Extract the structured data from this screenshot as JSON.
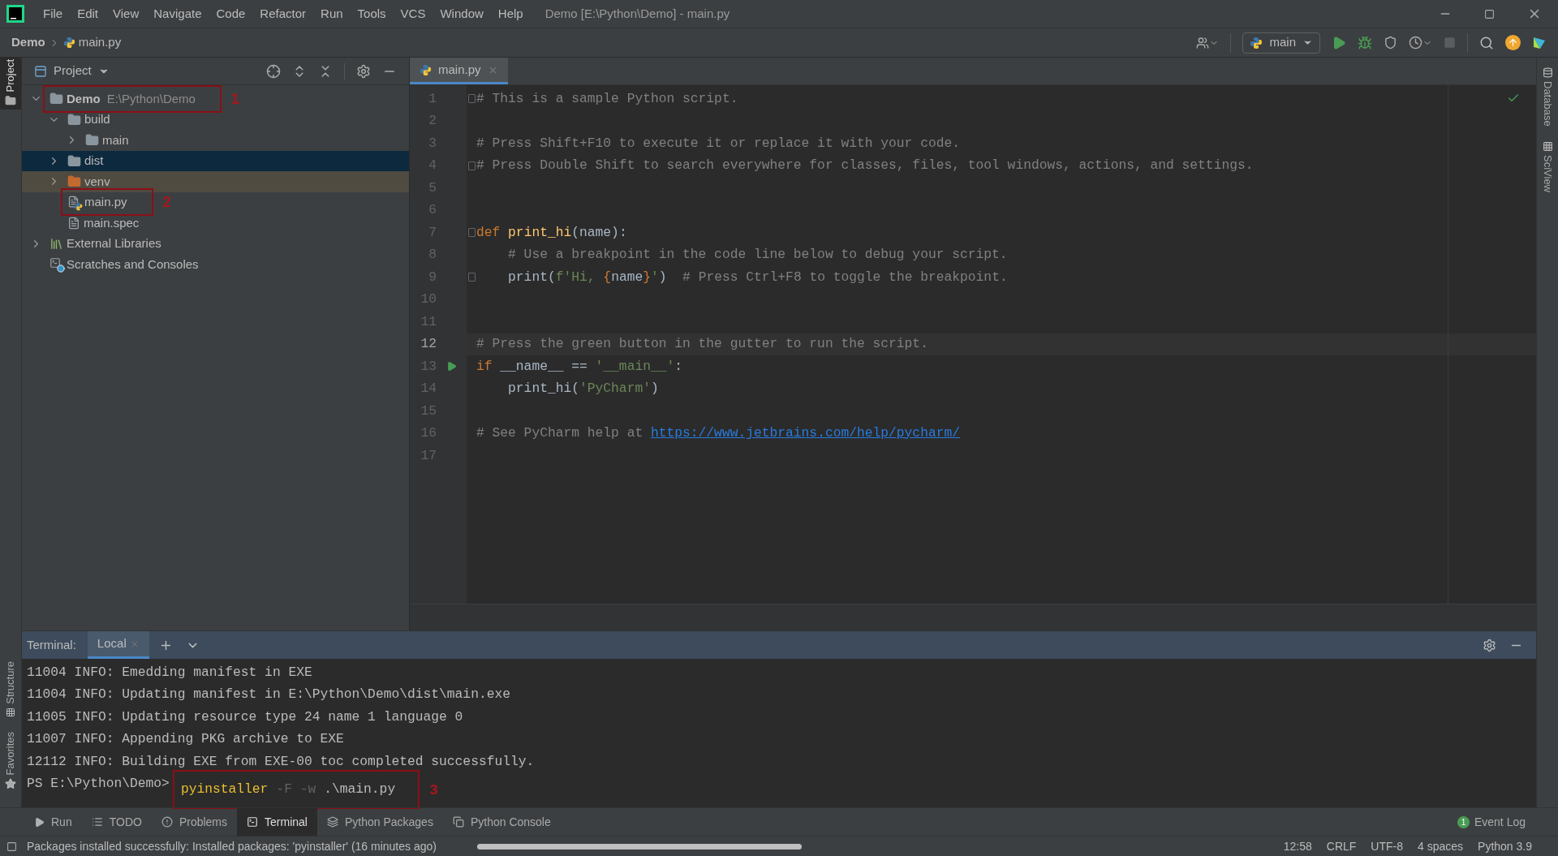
{
  "window": {
    "title": "Demo [E:\\Python\\Demo] - main.py"
  },
  "menu": [
    "File",
    "Edit",
    "View",
    "Navigate",
    "Code",
    "Refactor",
    "Run",
    "Tools",
    "VCS",
    "Window",
    "Help"
  ],
  "breadcrumbs": [
    "Demo",
    "main.py"
  ],
  "run_config": {
    "label": "main"
  },
  "left_strip": [
    {
      "label": "Project",
      "selected": true
    },
    {
      "label": "Structure",
      "selected": false
    },
    {
      "label": "Favorites",
      "selected": false
    }
  ],
  "right_strip": [
    {
      "label": "Database"
    },
    {
      "label": "SciView"
    }
  ],
  "project_panel": {
    "title": "Project",
    "tree": [
      {
        "label": "Demo",
        "path": "E:\\Python\\Demo",
        "kind": "folder",
        "expanded": true,
        "selected": false,
        "annotation": "1",
        "children": [
          {
            "label": "build",
            "kind": "folder",
            "expanded": true,
            "selected": false,
            "children": [
              {
                "label": "main",
                "kind": "folder",
                "expanded": false,
                "selected": false
              }
            ]
          },
          {
            "label": "dist",
            "kind": "folder",
            "expanded": false,
            "selected": true
          },
          {
            "label": "venv",
            "kind": "excluded",
            "expanded": false,
            "selected": false
          },
          {
            "label": "main.py",
            "kind": "python",
            "selected": false,
            "annotation": "2"
          },
          {
            "label": "main.spec",
            "kind": "file",
            "selected": false
          }
        ]
      },
      {
        "label": "External Libraries",
        "kind": "libraries",
        "expanded": false,
        "selected": false
      },
      {
        "label": "Scratches and Consoles",
        "kind": "scratches",
        "selected": false
      }
    ]
  },
  "editor": {
    "tabs": [
      {
        "label": "main.py",
        "selected": true
      }
    ],
    "lines": [
      {
        "number": "1",
        "current": false,
        "kind": "fold",
        "tokens": [
          {
            "kind": "comment",
            "t": "# This is a sample Python script."
          }
        ]
      },
      {
        "number": "2",
        "current": false,
        "kind": "plain"
      },
      {
        "number": "3",
        "current": false,
        "kind": "plain",
        "tokens": [
          {
            "kind": "comment",
            "t": "# Press Shift+F10 to execute it or replace it with your code."
          }
        ]
      },
      {
        "number": "4",
        "current": false,
        "kind": "fold",
        "tokens": [
          {
            "kind": "comment",
            "t": "# Press Double Shift to search everywhere for classes, files, tool windows, actions, and settings."
          }
        ]
      },
      {
        "number": "5",
        "current": false,
        "kind": "plain"
      },
      {
        "number": "6",
        "current": false,
        "kind": "plain"
      },
      {
        "number": "7",
        "current": false,
        "kind": "fold",
        "tokens": [
          {
            "kind": "keyword",
            "t": "def "
          },
          {
            "kind": "func",
            "t": "print_hi"
          },
          {
            "kind": "text",
            "t": "(name):"
          }
        ]
      },
      {
        "number": "8",
        "current": false,
        "kind": "plain",
        "tokens": [
          {
            "kind": "comment",
            "t": "    # Use a breakpoint in the code line below to debug your script."
          }
        ]
      },
      {
        "number": "9",
        "current": false,
        "kind": "fold",
        "tokens": [
          {
            "kind": "text",
            "t": "    print("
          },
          {
            "kind": "string",
            "t": "f'Hi, "
          },
          {
            "kind": "brace",
            "t": "{"
          },
          {
            "kind": "text",
            "t": "name"
          },
          {
            "kind": "brace",
            "t": "}"
          },
          {
            "kind": "string",
            "t": "'"
          },
          {
            "kind": "text",
            "t": ")  "
          },
          {
            "kind": "comment",
            "t": "# Press Ctrl+F8 to toggle the breakpoint."
          }
        ]
      },
      {
        "number": "10",
        "current": false,
        "kind": "plain"
      },
      {
        "number": "11",
        "current": false,
        "kind": "plain"
      },
      {
        "number": "12",
        "current": true,
        "kind": "plain",
        "tokens": [
          {
            "kind": "comment",
            "t": "# Press the green button in the gutter to run the script."
          }
        ]
      },
      {
        "number": "13",
        "current": false,
        "kind": "run",
        "tokens": [
          {
            "kind": "keyword",
            "t": "if "
          },
          {
            "kind": "text",
            "t": "__name__ == "
          },
          {
            "kind": "string",
            "t": "'__main__'"
          },
          {
            "kind": "text",
            "t": ":"
          }
        ]
      },
      {
        "number": "14",
        "current": false,
        "kind": "plain",
        "tokens": [
          {
            "kind": "text",
            "t": "    print_hi("
          },
          {
            "kind": "string",
            "t": "'PyCharm'"
          },
          {
            "kind": "text",
            "t": ")"
          }
        ]
      },
      {
        "number": "15",
        "current": false,
        "kind": "plain"
      },
      {
        "number": "16",
        "current": false,
        "kind": "plain",
        "tokens": [
          {
            "kind": "comment",
            "t": "# See PyCharm help at "
          },
          {
            "kind": "link",
            "t": "https://www.jetbrains.com/help/pycharm/"
          }
        ]
      },
      {
        "number": "17",
        "current": false,
        "kind": "plain"
      }
    ]
  },
  "terminal": {
    "title": "Terminal:",
    "tabs": [
      {
        "label": "Local",
        "selected": true
      }
    ],
    "output": [
      "11004 INFO: Emedding manifest in EXE",
      "11004 INFO: Updating manifest in E:\\Python\\Demo\\dist\\main.exe",
      "11005 INFO: Updating resource type 24 name 1 language 0",
      "11007 INFO: Appending PKG archive to EXE",
      "12112 INFO: Building EXE from EXE-00 toc completed successfully."
    ],
    "prompt": "PS E:\\Python\\Demo>",
    "command": "pyinstaller",
    "flags": "-F -w",
    "argument": ".\\main.py",
    "annotation": "3"
  },
  "tool_tabs": [
    {
      "label": "Run",
      "kind": "play",
      "selected": false
    },
    {
      "label": "TODO",
      "kind": "list",
      "selected": false
    },
    {
      "label": "Problems",
      "kind": "alert",
      "selected": false
    },
    {
      "label": "Terminal",
      "kind": "terminal",
      "selected": true
    },
    {
      "label": "Python Packages",
      "kind": "layers",
      "selected": false
    },
    {
      "label": "Python Console",
      "kind": "console",
      "selected": false
    }
  ],
  "event_log": {
    "label": "Event Log",
    "count": "1"
  },
  "status_bar": {
    "message": "Packages installed successfully: Installed packages: 'pyinstaller' (16 minutes ago)",
    "items": [
      "12:58",
      "CRLF",
      "UTF-8",
      "4 spaces",
      "Python 3.9"
    ]
  }
}
